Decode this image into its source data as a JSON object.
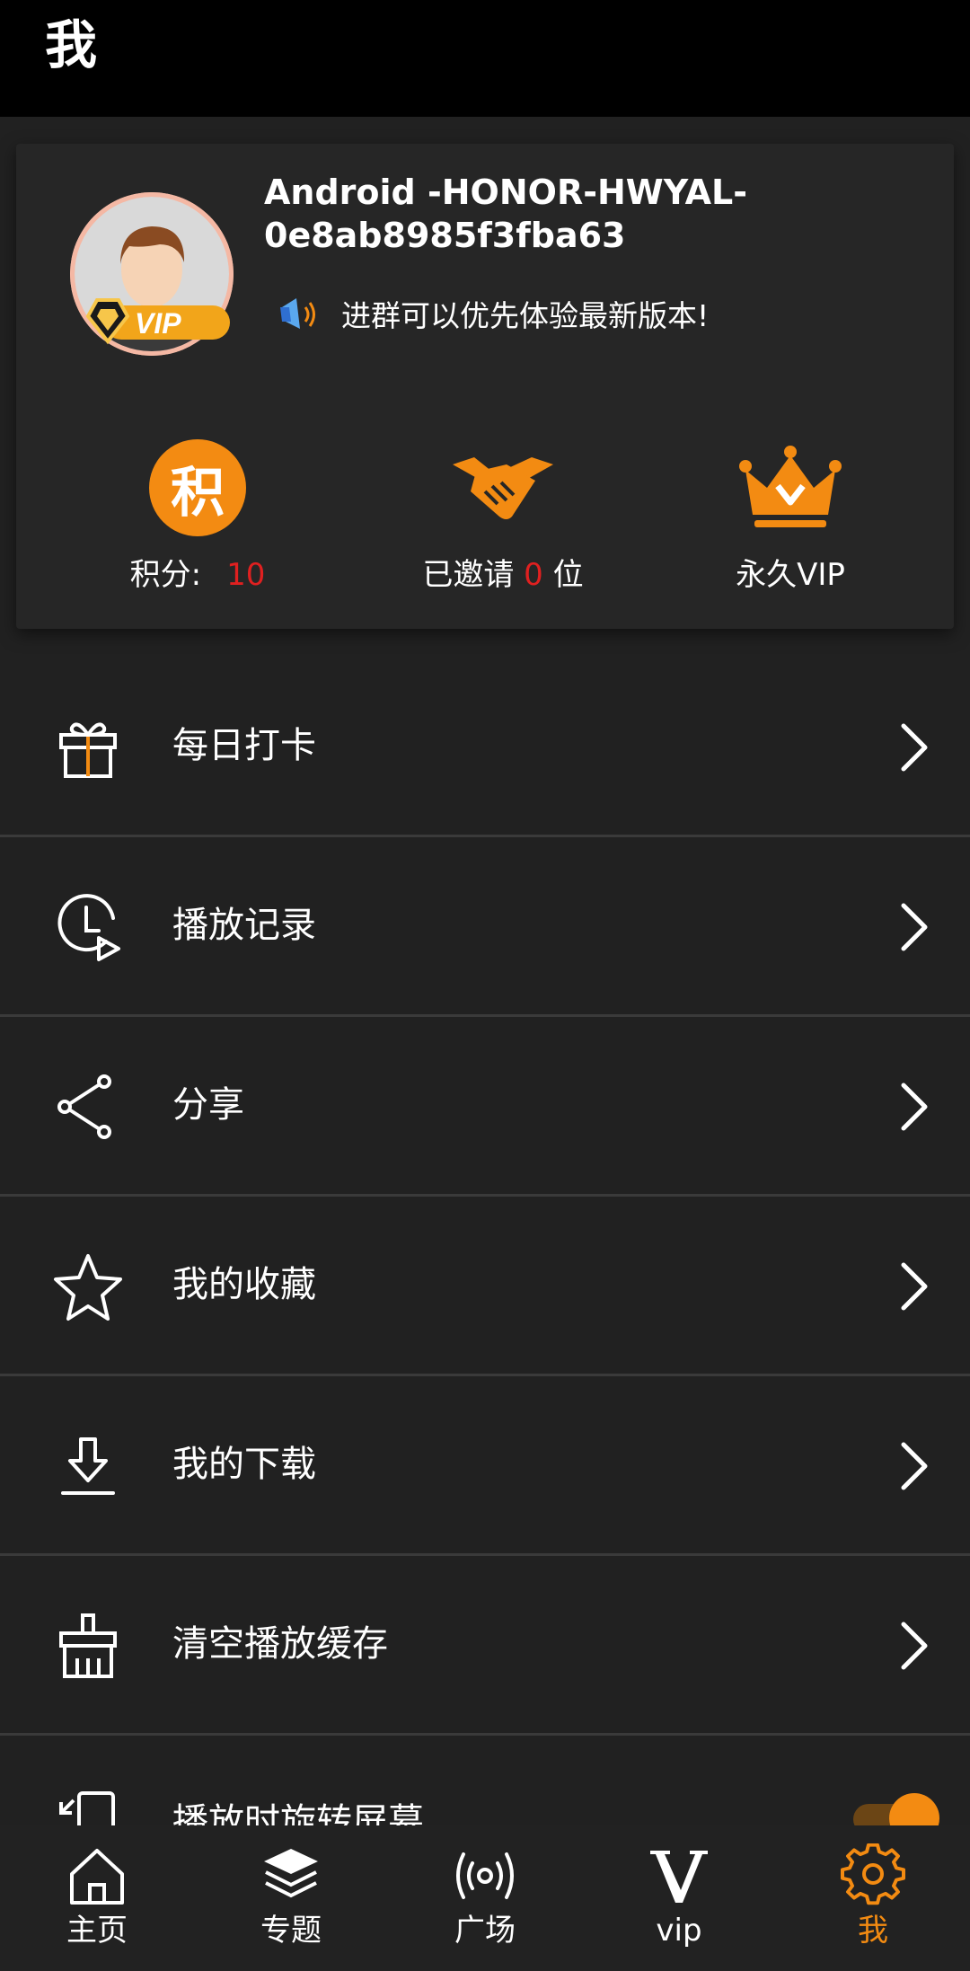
{
  "header": {
    "title": "我"
  },
  "profile": {
    "username": "Android -HONOR-HWYAL-0e8ab8985f3fba63",
    "vip_badge_text": "VIP",
    "notice": "进群可以优先体验最新版本!",
    "stats": [
      {
        "icon": "points-icon",
        "icon_char": "积",
        "label": "积分:",
        "value": "10"
      },
      {
        "icon": "handshake-icon",
        "label_prefix": "已邀请",
        "value": "0",
        "label_suffix": "位"
      },
      {
        "icon": "crown-icon",
        "label": "永久VIP"
      }
    ]
  },
  "menu": [
    {
      "icon": "gift-icon",
      "label": "每日打卡"
    },
    {
      "icon": "history-play-icon",
      "label": "播放记录"
    },
    {
      "icon": "share-icon",
      "label": "分享"
    },
    {
      "icon": "star-icon",
      "label": "我的收藏"
    },
    {
      "icon": "download-icon",
      "label": "我的下载"
    },
    {
      "icon": "broom-icon",
      "label": "清空播放缓存"
    }
  ],
  "partial_menu_item": {
    "icon": "rotate-screen-icon",
    "label": "播放时旋转屏幕",
    "toggle_on": true
  },
  "bottom_nav": [
    {
      "icon": "home-icon",
      "label": "主页",
      "active": false
    },
    {
      "icon": "layers-icon",
      "label": "专题",
      "active": false
    },
    {
      "icon": "broadcast-icon",
      "label": "广场",
      "active": false
    },
    {
      "icon": "vip-v-icon",
      "label": "vip",
      "active": false
    },
    {
      "icon": "gear-icon",
      "label": "我",
      "active": true
    }
  ],
  "colors": {
    "accent": "#f38b12",
    "highlight": "#e02020",
    "background": "#212121",
    "topbar": "#000000"
  }
}
